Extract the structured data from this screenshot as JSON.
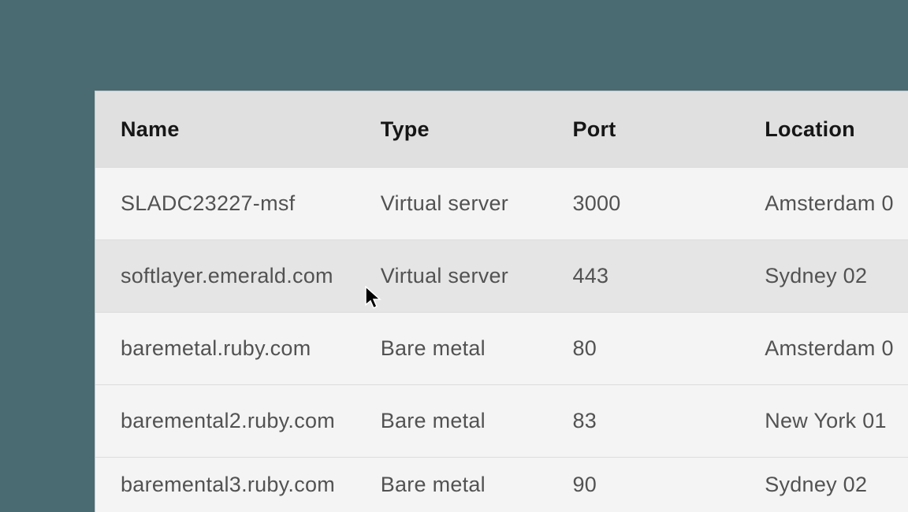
{
  "table": {
    "columns": {
      "name": "Name",
      "type": "Type",
      "port": "Port",
      "location": "Location"
    },
    "rows": [
      {
        "name": "SLADC23227-msf",
        "type": "Virtual server",
        "port": "3000",
        "location": "Amsterdam 0"
      },
      {
        "name": "softlayer.emerald.com",
        "type": "Virtual server",
        "port": "443",
        "location": "Sydney 02"
      },
      {
        "name": "baremetal.ruby.com",
        "type": "Bare metal",
        "port": "80",
        "location": "Amsterdam 0"
      },
      {
        "name": "baremental2.ruby.com",
        "type": "Bare metal",
        "port": "83",
        "location": "New York  01"
      },
      {
        "name": "baremental3.ruby.com",
        "type": "Bare metal",
        "port": "90",
        "location": "Sydney 02"
      }
    ]
  }
}
